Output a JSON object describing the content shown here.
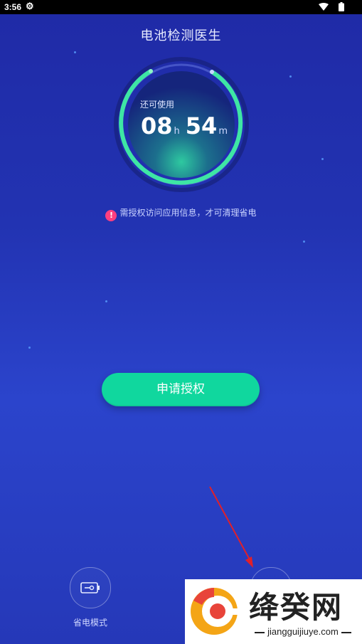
{
  "statusbar": {
    "time": "3:56",
    "gear_icon": "gear-icon",
    "wifi_icon": "wifi-icon",
    "battery_icon": "battery-icon"
  },
  "header": {
    "title": "电池检测医生"
  },
  "gauge": {
    "label": "还可使用",
    "hours": "08",
    "hours_unit": "h",
    "minutes": "54",
    "minutes_unit": "m",
    "accent": "#3ee6a4"
  },
  "notice": {
    "text": "需授权访问应用信息，才可清理省电",
    "icon": "alert-icon",
    "icon_color": "#ff3f7f"
  },
  "primary_button": {
    "label": "申请授权",
    "color": "#10d79e"
  },
  "bottom_nav": {
    "items": [
      {
        "label": "省电模式",
        "icon": "battery-saver-icon"
      }
    ]
  },
  "watermark": {
    "name": "绛癸网",
    "domain": "jiangguijiuye.com"
  }
}
